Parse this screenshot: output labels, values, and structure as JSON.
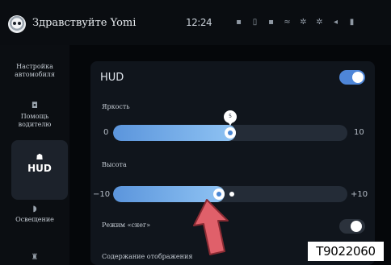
{
  "header": {
    "greeting": "Здравствуйте Yomi",
    "time": "12:24",
    "status_icons": [
      "signal-icon",
      "battery-icon",
      "network-icon",
      "wifi-icon",
      "fan-icon",
      "fan-2-icon",
      "volume-icon",
      "cellular-icon"
    ]
  },
  "sidebar": {
    "items": [
      {
        "label": "Настройка\nавтомобиля",
        "icon": "car-settings-icon",
        "active": false
      },
      {
        "label": "Помощь\nводителю",
        "icon": "driver-assist-icon",
        "active": false
      },
      {
        "label": "HUD",
        "icon": "hud-icon",
        "active": true
      },
      {
        "label": "Освещение",
        "icon": "lighting-icon",
        "active": false
      },
      {
        "label": "",
        "icon": "seat-icon",
        "active": false
      }
    ]
  },
  "main": {
    "title": "HUD",
    "hud_toggle": true,
    "brightness": {
      "label": "Яркость",
      "min": "0",
      "max": "10",
      "value": 5,
      "range": [
        0,
        10
      ],
      "bubble": "5"
    },
    "height": {
      "label": "Высота",
      "min": "−10",
      "max": "+10",
      "value": -1,
      "range": [
        -10,
        10
      ]
    },
    "snow_mode": {
      "label": "Режим «снег»",
      "enabled": false
    },
    "display_content": {
      "label": "Содержание отображения"
    }
  },
  "annotation": {
    "code": "T9022060"
  },
  "colors": {
    "accent": "#4e86d8",
    "arrow": "#e0606a"
  }
}
